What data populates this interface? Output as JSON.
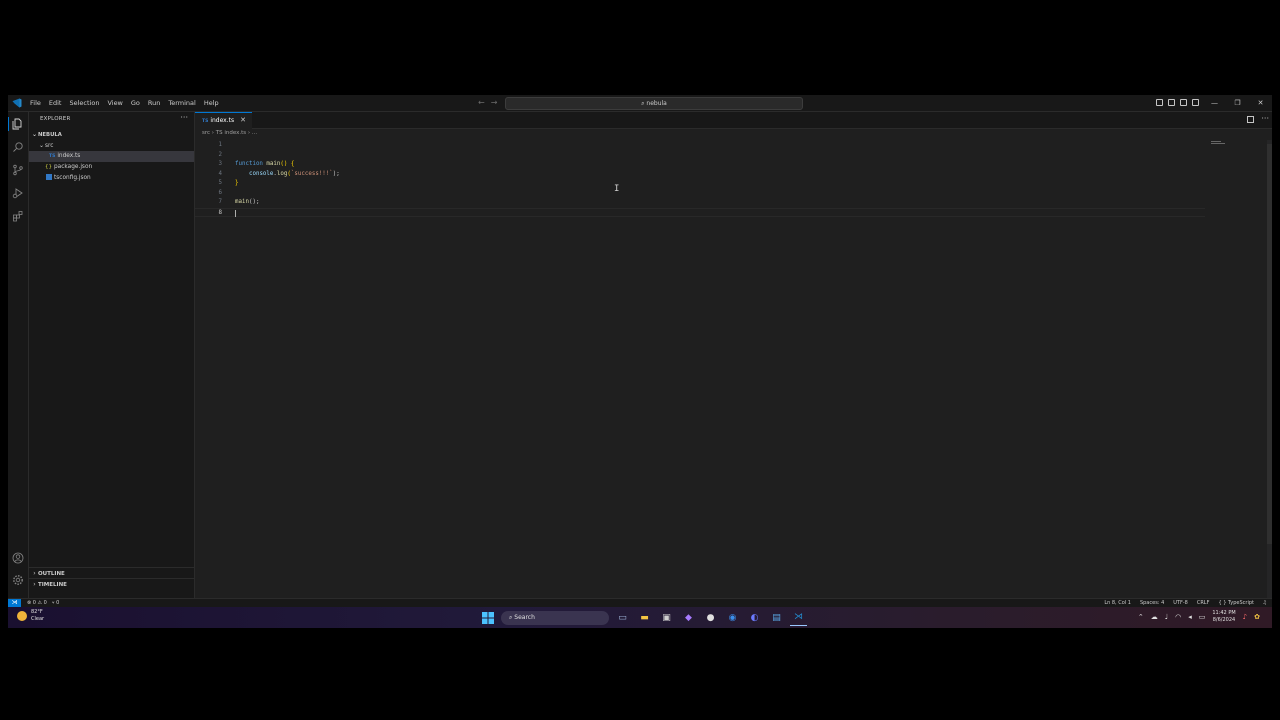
{
  "titlebar": {
    "menu": [
      "File",
      "Edit",
      "Selection",
      "View",
      "Go",
      "Run",
      "Terminal",
      "Help"
    ],
    "search_text": "nebula"
  },
  "sidebar": {
    "title": "EXPLORER",
    "project": "NEBULA",
    "folder": "src",
    "file_active": "index.ts",
    "file_package": "package.json",
    "file_tsconfig": "tsconfig.json",
    "outline": "OUTLINE",
    "timeline": "TIMELINE"
  },
  "editor": {
    "tab_label": "index.ts",
    "breadcrumb": "src › TS index.ts › ...",
    "lines": {
      "l3_kw": "function",
      "l3_fn": "main",
      "l3_rest": "() {",
      "l4_obj": "console",
      "l4_fn": "log",
      "l4_str": "`success!!!`",
      "l4_end": ");",
      "l5": "}",
      "l7_fn": "main",
      "l7_rest": "();"
    }
  },
  "statusbar": {
    "problems": "⊗ 0 ⚠ 0",
    "ports": "⑂ 0",
    "position": "Ln 8, Col 1",
    "spaces": "Spaces: 4",
    "encoding": "UTF-8",
    "eol": "CRLF",
    "language": "{ } TypeScript"
  },
  "taskbar": {
    "temp": "82°F",
    "weather": "Clear",
    "search": "Search",
    "time": "11:42 PM",
    "date": "8/6/2024"
  }
}
